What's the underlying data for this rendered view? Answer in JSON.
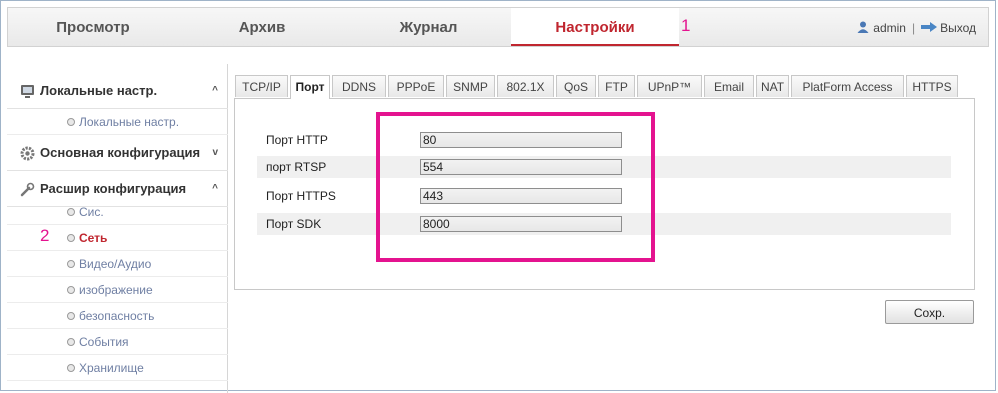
{
  "nav": {
    "tabs": [
      {
        "label": "Просмотр"
      },
      {
        "label": "Архив"
      },
      {
        "label": "Журнал"
      },
      {
        "label": "Настройки"
      }
    ],
    "annotation": "1",
    "user": "admin",
    "separator": "|",
    "logout": "Выход"
  },
  "sidebar": {
    "sections": [
      {
        "label": "Локальные настр.",
        "caret": "^",
        "icon": "local-config-icon"
      },
      {
        "label": "Основная конфигурация",
        "caret": "v",
        "icon": "gear-icon"
      },
      {
        "label": "Расшир конфигурация",
        "caret": "^",
        "icon": "wrench-icon"
      }
    ],
    "local_items": [
      {
        "label": "Локальные настр."
      }
    ],
    "advanced_items": [
      {
        "label": "Сис."
      },
      {
        "label": "Сеть"
      },
      {
        "label": "Видео/Аудио"
      },
      {
        "label": "изображение"
      },
      {
        "label": "безопасность"
      },
      {
        "label": "События"
      },
      {
        "label": "Хранилище"
      }
    ],
    "annotation": "2"
  },
  "tabs": [
    "TCP/IP",
    "Порт",
    "DDNS",
    "PPPoE",
    "SNMP",
    "802.1X",
    "QoS",
    "FTP",
    "UPnP™",
    "Email",
    "NAT",
    "PlatForm Access",
    "HTTPS"
  ],
  "ports": {
    "http": {
      "label": "Порт HTTP",
      "value": "80"
    },
    "rtsp": {
      "label": "порт RTSP",
      "value": "554"
    },
    "https": {
      "label": "Порт HTTPS",
      "value": "443"
    },
    "sdk": {
      "label": "Порт SDK",
      "value": "8000"
    }
  },
  "save_label": "Сохр.",
  "colors": {
    "accent": "#c0262f",
    "annotation": "#e4138f",
    "link": "#6f7fa3"
  }
}
